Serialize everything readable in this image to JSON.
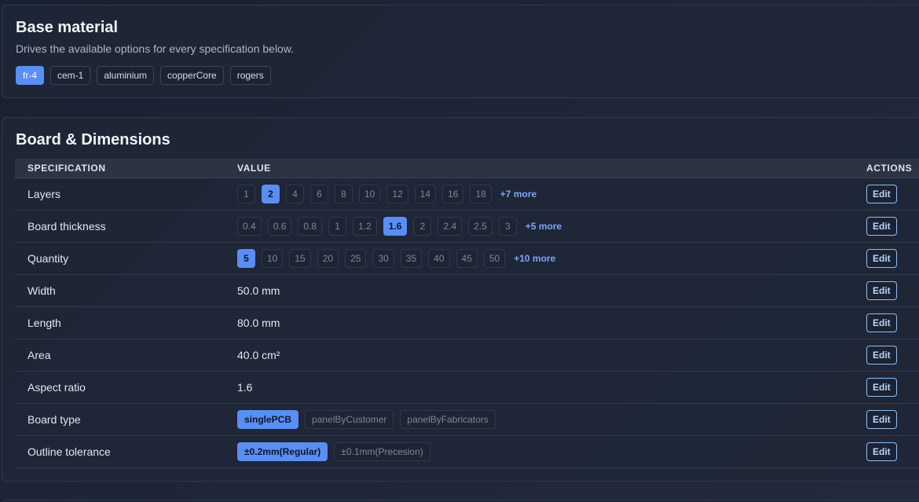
{
  "material": {
    "title": "Base material",
    "description": "Drives the available options for every specification below.",
    "options": [
      "fr-4",
      "cem-1",
      "aluminium",
      "copperCore",
      "rogers"
    ],
    "selected": "fr-4"
  },
  "board": {
    "title": "Board & Dimensions",
    "columns": {
      "spec": "SPECIFICATION",
      "value": "VALUE",
      "actions": "ACTIONS"
    },
    "edit_label": "Edit",
    "rows": [
      {
        "label": "Layers",
        "options": [
          "1",
          "2",
          "4",
          "6",
          "8",
          "10",
          "12",
          "14",
          "16",
          "18"
        ],
        "selected": "2",
        "more": "+7 more"
      },
      {
        "label": "Board thickness",
        "options": [
          "0.4",
          "0.6",
          "0.8",
          "1",
          "1.2",
          "1.6",
          "2",
          "2.4",
          "2.5",
          "3"
        ],
        "selected": "1.6",
        "more": "+5 more"
      },
      {
        "label": "Quantity",
        "options": [
          "5",
          "10",
          "15",
          "20",
          "25",
          "30",
          "35",
          "40",
          "45",
          "50"
        ],
        "selected": "5",
        "more": "+10 more"
      },
      {
        "label": "Width",
        "value": "50.0 mm"
      },
      {
        "label": "Length",
        "value": "80.0 mm"
      },
      {
        "label": "Area",
        "value": "40.0 cm²"
      },
      {
        "label": "Aspect ratio",
        "value": "1.6"
      },
      {
        "label": "Board type",
        "options": [
          "singlePCB",
          "panelByCustomer",
          "panelByFabricators"
        ],
        "selected": "singlePCB"
      },
      {
        "label": "Outline tolerance",
        "options": [
          "±0.2mm(Regular)",
          "±0.1mm(Precesion)"
        ],
        "selected": "±0.2mm(Regular)"
      }
    ]
  },
  "colors": {
    "accent": "#5a8ef5",
    "edit_border": "#8fbdf2",
    "more_link": "#7fa6f5"
  }
}
